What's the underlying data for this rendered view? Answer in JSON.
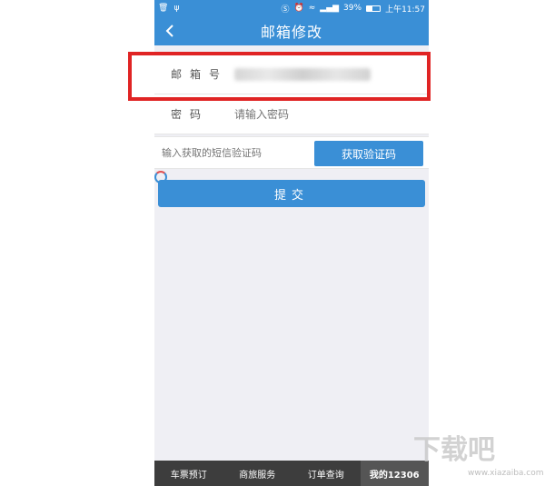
{
  "status_bar": {
    "battery": "39%",
    "time": "上午11:57"
  },
  "title_bar": {
    "title": "邮箱修改"
  },
  "form": {
    "email_label": "邮箱号",
    "password_label": "密码",
    "password_placeholder": "请输入密码",
    "sms_placeholder": "输入获取的短信验证码",
    "get_code_label": "获取验证码",
    "submit_label": "提交"
  },
  "bottom_nav": {
    "items": [
      {
        "label": "车票预订"
      },
      {
        "label": "商旅服务"
      },
      {
        "label": "订单查询"
      },
      {
        "label": "我的12306"
      }
    ]
  },
  "watermark": {
    "text": "下载吧",
    "url": "www.xiazaiba.com"
  },
  "colors": {
    "primary": "#3a8fd6",
    "highlight": "#e02424",
    "nav_bg": "#3d3d3d"
  }
}
